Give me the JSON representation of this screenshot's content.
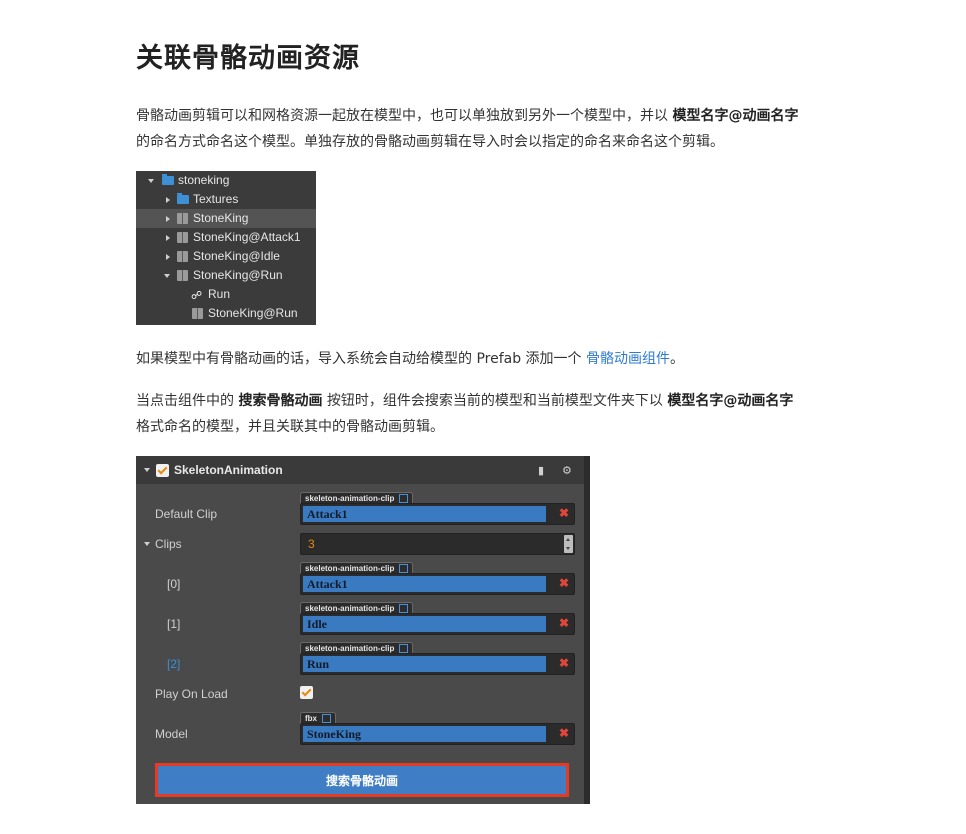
{
  "title": "关联骨骼动画资源",
  "para1": {
    "line1_pre": "骨骼动画剪辑可以和网格资源一起放在模型中，也可以单独放到另外一个模型中，并以 ",
    "line1_bold": "模型名字@动画名字",
    "line2": "的命名方式命名这个模型。单独存放的骨骼动画剪辑在导入时会以指定的命名来命名这个剪辑。"
  },
  "tree": {
    "items": [
      {
        "label": "stoneking",
        "icon": "folder-icon",
        "expand": "down"
      },
      {
        "label": "Textures",
        "icon": "folder-icon",
        "expand": "right"
      },
      {
        "label": "StoneKing",
        "icon": "model-icon",
        "expand": "right"
      },
      {
        "label": "StoneKing@Attack1",
        "icon": "model-icon",
        "expand": "right"
      },
      {
        "label": "StoneKing@Idle",
        "icon": "model-icon",
        "expand": "right"
      },
      {
        "label": "StoneKing@Run",
        "icon": "model-icon",
        "expand": "down"
      },
      {
        "label": "Run",
        "icon": "animation-clip-icon",
        "expand": "none"
      },
      {
        "label": "StoneKing@Run",
        "icon": "model-icon",
        "expand": "none"
      }
    ]
  },
  "para2": {
    "text": "如果模型中有骨骼动画的话，导入系统会自动给模型的 Prefab 添加一个 ",
    "link": "骨骼动画组件",
    "end": "。"
  },
  "para3": {
    "pre": "当点击组件中的 ",
    "bold1": "搜索骨骼动画",
    "mid": " 按钮时，组件会搜索当前的模型和当前模型文件夹下以 ",
    "bold2": "模型名字@动画名字",
    "line2": "格式命名的模型，并且关联其中的骨骼动画剪辑。"
  },
  "inspector": {
    "component_title": "SkeletonAnimation",
    "enabled": true,
    "default_clip": {
      "label": "Default Clip",
      "type": "skeleton-animation-clip",
      "value": "Attack1"
    },
    "clips": {
      "label": "Clips",
      "count": "3",
      "items": [
        {
          "label": "[0]",
          "type": "skeleton-animation-clip",
          "value": "Attack1"
        },
        {
          "label": "[1]",
          "type": "skeleton-animation-clip",
          "value": "Idle"
        },
        {
          "label": "[2]",
          "type": "skeleton-animation-clip",
          "value": "Run"
        }
      ]
    },
    "play_on_load": {
      "label": "Play On Load",
      "checked": true
    },
    "model": {
      "label": "Model",
      "type": "fbx",
      "value": "StoneKing"
    },
    "search_button": "搜索骨骼动画",
    "remove_glyph": "✖",
    "header_icons": [
      "book-icon",
      "gear-icon"
    ]
  }
}
